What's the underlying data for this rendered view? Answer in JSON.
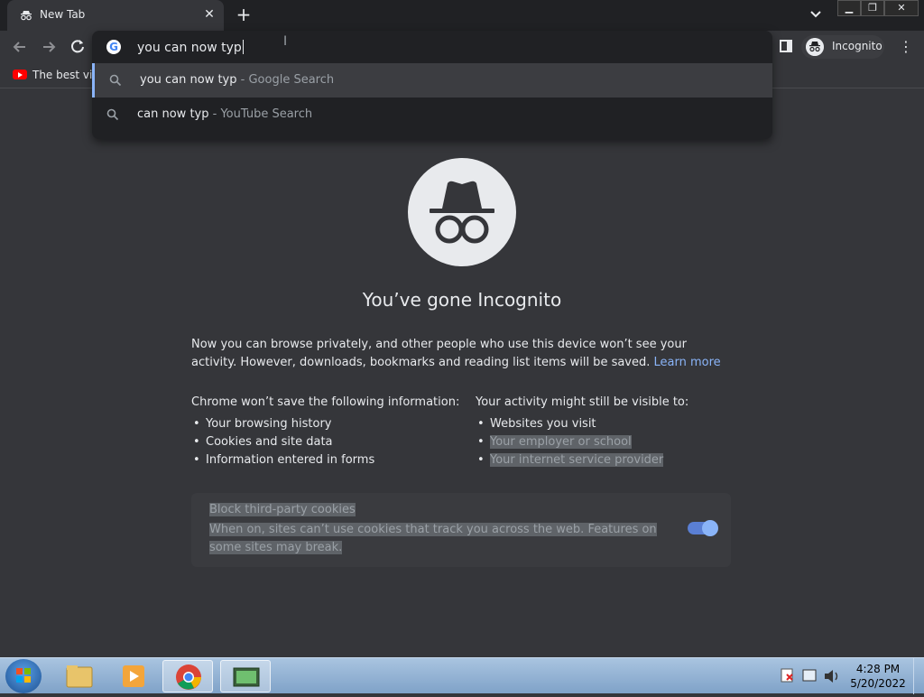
{
  "tab": {
    "title": "New Tab"
  },
  "toolbar": {
    "profile_label": "Incognito"
  },
  "bookmarks": {
    "item1": "The best vid"
  },
  "omnibox": {
    "text": "you can now typ",
    "suggestions": [
      {
        "query": "you can now typ",
        "source": " - Google Search"
      },
      {
        "query": "can now typ",
        "source": " - YouTube Search"
      }
    ]
  },
  "page": {
    "headline": "You’ve gone Incognito",
    "intro": "Now you can browse privately, and other people who use this device won’t see your activity. However, downloads, bookmarks and reading list items will be saved.",
    "learn_more": "Learn more",
    "left_title": "Chrome won’t save the following information:",
    "left_items": [
      "Your browsing history",
      "Cookies and site data",
      "Information entered in forms"
    ],
    "right_title": "Your activity might still be visible to:",
    "right_items": [
      "Websites you visit",
      "Your employer or school",
      "Your internet service provider"
    ],
    "cookies_title": "Block third-party cookies",
    "cookies_desc": "When on, sites can’t use cookies that track you across the web. Features on some sites may break."
  },
  "taskbar": {
    "time": "4:28 PM",
    "date": "5/20/2022"
  }
}
